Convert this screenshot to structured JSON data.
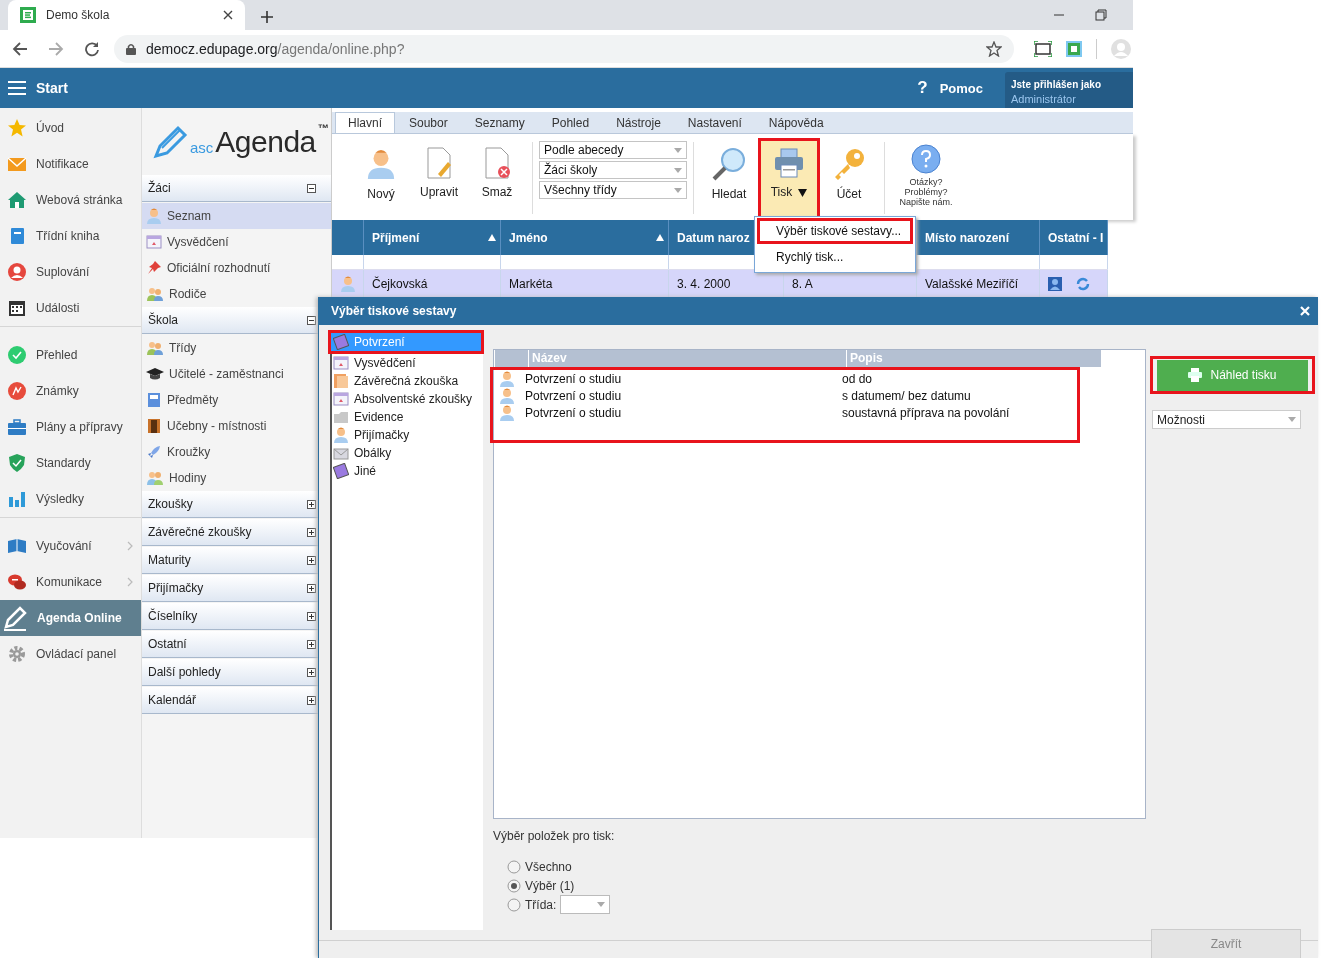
{
  "browser": {
    "tab_title": "Demo škola",
    "url_host": "democz.edupage.org",
    "url_path": "/agenda/online.php?"
  },
  "header": {
    "menu_label": "Start",
    "help_mark": "?",
    "help_label": "Pomoc",
    "user_caption": "Jste přihlášen jako",
    "user_role": "Administrátor"
  },
  "nav": {
    "groups": [
      {
        "items": [
          {
            "label": "Úvod",
            "selected": false,
            "submenu": false
          },
          {
            "label": "Notifikace",
            "selected": false,
            "submenu": false
          },
          {
            "label": "Webová stránka",
            "selected": false,
            "submenu": false
          },
          {
            "label": "Třídní kniha",
            "selected": false,
            "submenu": false
          },
          {
            "label": "Suplování",
            "selected": false,
            "submenu": false
          },
          {
            "label": "Události",
            "selected": false,
            "submenu": false
          }
        ]
      },
      {
        "items": [
          {
            "label": "Přehled",
            "selected": false,
            "submenu": false
          },
          {
            "label": "Známky",
            "selected": false,
            "submenu": false
          },
          {
            "label": "Plány a přípravy",
            "selected": false,
            "submenu": false
          },
          {
            "label": "Standardy",
            "selected": false,
            "submenu": false
          },
          {
            "label": "Výsledky",
            "selected": false,
            "submenu": false
          }
        ]
      },
      {
        "items": [
          {
            "label": "Vyučování",
            "selected": false,
            "submenu": true
          },
          {
            "label": "Komunikace",
            "selected": false,
            "submenu": true
          },
          {
            "label": "Agenda Online",
            "selected": true,
            "submenu": false
          },
          {
            "label": "Ovládací panel",
            "selected": false,
            "submenu": false
          }
        ]
      }
    ]
  },
  "tree": {
    "logo": {
      "prefix": "asc",
      "name": "Agenda",
      "mark": "™"
    },
    "sections": [
      {
        "title": "Žáci",
        "expanded": true,
        "items": [
          {
            "label": "Seznam",
            "selected": true
          },
          {
            "label": "Vysvědčení",
            "selected": false
          },
          {
            "label": "Oficiální rozhodnutí",
            "selected": false
          },
          {
            "label": "Rodiče",
            "selected": false
          }
        ]
      },
      {
        "title": "Škola",
        "expanded": true,
        "items": [
          {
            "label": "Třídy",
            "selected": false
          },
          {
            "label": "Učitelé - zaměstnanci",
            "selected": false
          },
          {
            "label": "Předměty",
            "selected": false
          },
          {
            "label": "Učebny - místnosti",
            "selected": false
          },
          {
            "label": "Kroužky",
            "selected": false
          },
          {
            "label": "Hodiny",
            "selected": false
          }
        ]
      },
      {
        "title": "Zkoušky",
        "expanded": false
      },
      {
        "title": "Závěrečné zkoušky",
        "expanded": false
      },
      {
        "title": "Maturity",
        "expanded": false
      },
      {
        "title": "Přijímačky",
        "expanded": false
      },
      {
        "title": "Číselníky",
        "expanded": false
      },
      {
        "title": "Ostatní",
        "expanded": false
      },
      {
        "title": "Další pohledy",
        "expanded": false
      },
      {
        "title": "Kalendář",
        "expanded": false
      }
    ]
  },
  "ribbon": {
    "tabs": [
      {
        "label": "Hlavní",
        "selected": true
      },
      {
        "label": "Soubor",
        "selected": false
      },
      {
        "label": "Seznamy",
        "selected": false
      },
      {
        "label": "Pohled",
        "selected": false
      },
      {
        "label": "Nástroje",
        "selected": false
      },
      {
        "label": "Nastavení",
        "selected": false
      },
      {
        "label": "Nápověda",
        "selected": false
      }
    ],
    "buttons": [
      {
        "label": "Nový"
      },
      {
        "label": "Upravit"
      },
      {
        "label": "Smaž"
      }
    ],
    "selects": [
      "Podle abecedy",
      "Žáci školy",
      "Všechny třídy"
    ],
    "tools": [
      {
        "label": "Hledat",
        "active": false,
        "dropdown": false,
        "annotated": false
      },
      {
        "label": "Tisk",
        "active": true,
        "dropdown": true,
        "annotated": true
      },
      {
        "label": "Účet",
        "active": false,
        "dropdown": false,
        "annotated": false
      }
    ],
    "help_text": "Otázky?\nProblémy?\nNapište nám."
  },
  "print_menu": {
    "items": [
      {
        "label": "Výběr tiskové sestavy...",
        "annotated": true
      },
      {
        "label": "Rychlý tisk...",
        "annotated": false
      }
    ]
  },
  "table": {
    "columns": [
      {
        "label": "Příjmení",
        "sorted": true
      },
      {
        "label": "Jméno",
        "sorted": true
      },
      {
        "label": "Datum naroz"
      },
      {},
      {
        "label": "Místo narození",
        "sorted": false
      },
      {
        "label": "Ostatní - I",
        "sorted": false
      }
    ],
    "rows": [
      {
        "cells": [
          "Čejkovská",
          "Markéta",
          "3. 4. 2000",
          "8. A",
          "Valašské Meziříčí"
        ],
        "selected": true
      }
    ]
  },
  "dialog": {
    "title": "Výběr tiskové sestavy",
    "categories": [
      {
        "label": "Potvrzení",
        "selected": true,
        "annotated": true
      },
      {
        "label": "Vysvědčení",
        "selected": false,
        "annotated": false
      },
      {
        "label": "Závěrečná zkouška",
        "selected": false,
        "annotated": false
      },
      {
        "label": "Absolventské zkoušky",
        "selected": false,
        "annotated": false
      },
      {
        "label": "Evidence",
        "selected": false,
        "annotated": false
      },
      {
        "label": "Přijímačky",
        "selected": false,
        "annotated": false
      },
      {
        "label": "Obálky",
        "selected": false,
        "annotated": false
      },
      {
        "label": "Jiné",
        "selected": false,
        "annotated": false
      }
    ],
    "report_table": {
      "columns": [
        "Název",
        "Popis"
      ],
      "rows_annotated": true,
      "rows": [
        {
          "name": "Potvrzení o studiu",
          "description": "od do"
        },
        {
          "name": "Potvrzení o studiu",
          "description": "s datumem/ bez datumu"
        },
        {
          "name": "Potvrzení o studiu",
          "description": "soustavná příprava na povolání"
        }
      ]
    },
    "preview_button": {
      "label": "Náhled tisku",
      "annotated": true
    },
    "options_select": "Možnosti",
    "selection_label": "Výběr položek pro tisk:",
    "scope_options": [
      {
        "label": "Všechno",
        "selected": false,
        "kind": "plain"
      },
      {
        "label": "Výběr (1)",
        "selected": true,
        "kind": "plain"
      },
      {
        "label": "Třída:",
        "selected": false,
        "kind": "with-select"
      }
    ],
    "close_button": {
      "label": "Zavřít",
      "disabled": true
    }
  }
}
